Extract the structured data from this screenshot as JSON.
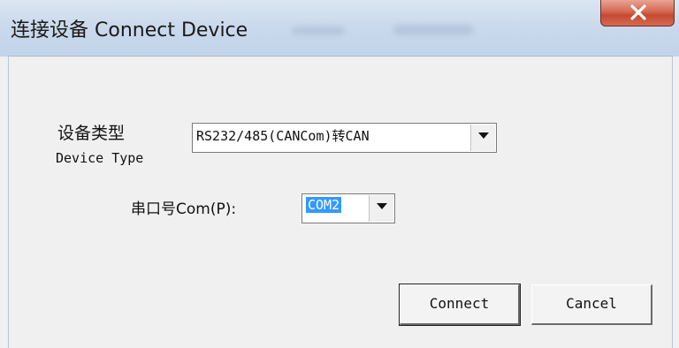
{
  "window": {
    "title": "连接设备 Connect Device",
    "close_label": "X"
  },
  "device_type": {
    "label_cn": "设备类型",
    "label_en": "Device Type",
    "selected_value": "RS232/485(CANCom)转CAN"
  },
  "com_port": {
    "label": "串口号Com(P):",
    "selected_value": "COM2"
  },
  "buttons": {
    "connect": "Connect",
    "cancel": "Cancel"
  },
  "icons": {
    "close": "close-icon",
    "dropdown": "chevron-down-icon"
  },
  "colors": {
    "title_bar": "#c8d7eb",
    "close_button": "#c54a33",
    "selection_highlight": "#3399ff",
    "dialog_background": "#f0f0f0"
  }
}
